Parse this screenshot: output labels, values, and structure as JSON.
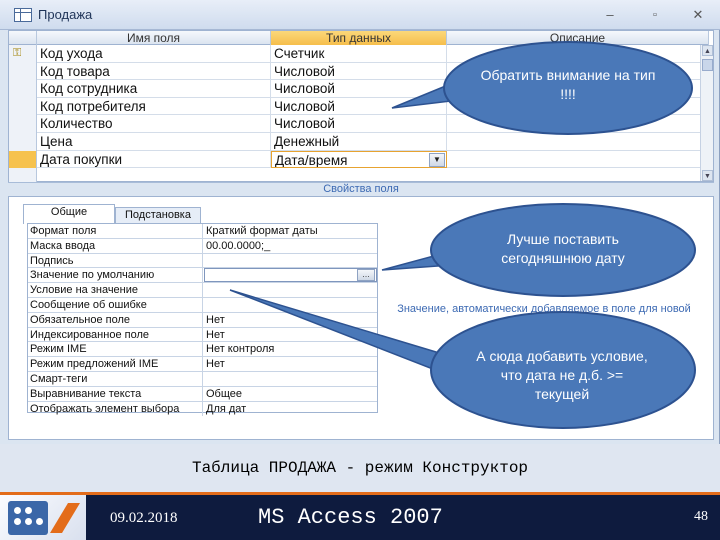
{
  "window": {
    "title": "Продажа"
  },
  "design_grid": {
    "headers": [
      "Имя поля",
      "Тип данных",
      "Описание"
    ],
    "rows": [
      {
        "name": "Код ухода",
        "type": "Счетчик",
        "primary_key": true
      },
      {
        "name": "Код товара",
        "type": "Числовой"
      },
      {
        "name": "Код сотрудника",
        "type": "Числовой"
      },
      {
        "name": "Код потребителя",
        "type": "Числовой"
      },
      {
        "name": "Количество",
        "type": "Числовой"
      },
      {
        "name": "Цена",
        "type": "Денежный"
      },
      {
        "name": "Дата покупки",
        "type": "Дата/время",
        "selected": true
      }
    ]
  },
  "field_properties": {
    "label": "Свойства поля",
    "tabs": [
      "Общие",
      "Подстановка"
    ],
    "rows": [
      {
        "label": "Формат поля",
        "value": "Краткий формат даты"
      },
      {
        "label": "Маска ввода",
        "value": "00.00.0000;_"
      },
      {
        "label": "Подпись",
        "value": ""
      },
      {
        "label": "Значение по умолчанию",
        "value": ""
      },
      {
        "label": "Условие на значение",
        "value": ""
      },
      {
        "label": "Сообщение об ошибке",
        "value": ""
      },
      {
        "label": "Обязательное поле",
        "value": "Нет"
      },
      {
        "label": "Индексированное поле",
        "value": "Нет"
      },
      {
        "label": "Режим IME",
        "value": "Нет контроля"
      },
      {
        "label": "Режим предложений IME",
        "value": "Нет"
      },
      {
        "label": "Смарт-теги",
        "value": ""
      },
      {
        "label": "Выравнивание текста",
        "value": "Общее"
      },
      {
        "label": "Отображать элемент выбора",
        "value": "Для дат"
      }
    ],
    "help_text": "Значение, автоматически добавляемое в поле для новой записи"
  },
  "callouts": [
    {
      "text": "Обратить внимание на тип !!!!"
    },
    {
      "text": "Лучше поставить сегодняшнюю дату"
    },
    {
      "text": "А сюда добавить условие, что дата не д.б. >= текущей"
    }
  ],
  "callout_color": "#4a78b8",
  "caption": "Таблица ПРОДАЖА - режим Конструктор",
  "footer": {
    "date": "09.02.2018",
    "app": "MS Access 2007",
    "page": "48"
  }
}
